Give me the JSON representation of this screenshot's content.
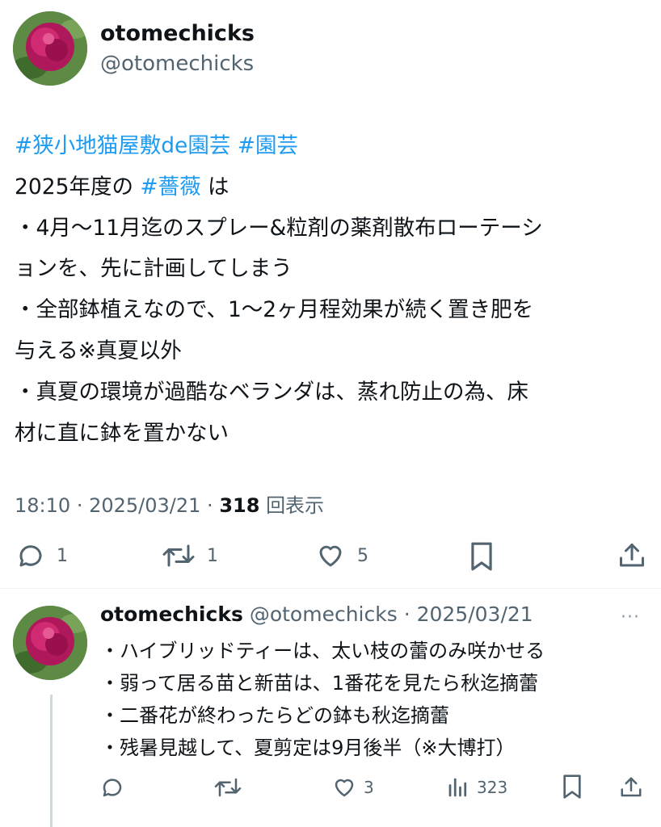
{
  "post": {
    "author_name": "otomechicks",
    "author_handle": "@otomechicks",
    "hashtags_line": [
      "#狭小地猫屋敷de園芸",
      "#園芸"
    ],
    "line2_prefix": "2025年度の ",
    "line2_tag": "#薔薇",
    "line2_suffix": " は",
    "lines": [
      "・4月〜11月迄のスプレー&粒剤の薬剤散布ローテーシ",
      "ョンを、先に計画してしまう",
      "・全部鉢植えなので、1〜2ヶ月程効果が続く置き肥を",
      "与える※真夏以外",
      "・真夏の環境が過酷なベランダは、蒸れ防止の為、床",
      "材に直に鉢を置かない"
    ],
    "time": "18:10",
    "date": "2025/03/21",
    "views_count": "318",
    "views_label": "回表示",
    "reply_count": "1",
    "repost_count": "1",
    "like_count": "5"
  },
  "reply": {
    "author_name": "otomechicks",
    "author_handle": "@otomechicks",
    "date": "2025/03/21",
    "more": "···",
    "lines": [
      "・ハイブリッドティーは、太い枝の蕾のみ咲かせる",
      "・弱って居る苗と新苗は、1番花を見たら秋迄摘蕾",
      "・二番花が終わったらどの鉢も秋迄摘蕾",
      "・残暑見越して、夏剪定は9月後半（※大博打）"
    ],
    "like_count": "3",
    "views_count": "323"
  },
  "icons": [
    "reply-icon",
    "repost-icon",
    "like-icon",
    "bookmark-icon",
    "share-icon",
    "views-icon"
  ],
  "colors": {
    "link": "#1d9bf0",
    "secondary": "#536471",
    "text": "#0f1419",
    "divider": "#eff3f4"
  }
}
